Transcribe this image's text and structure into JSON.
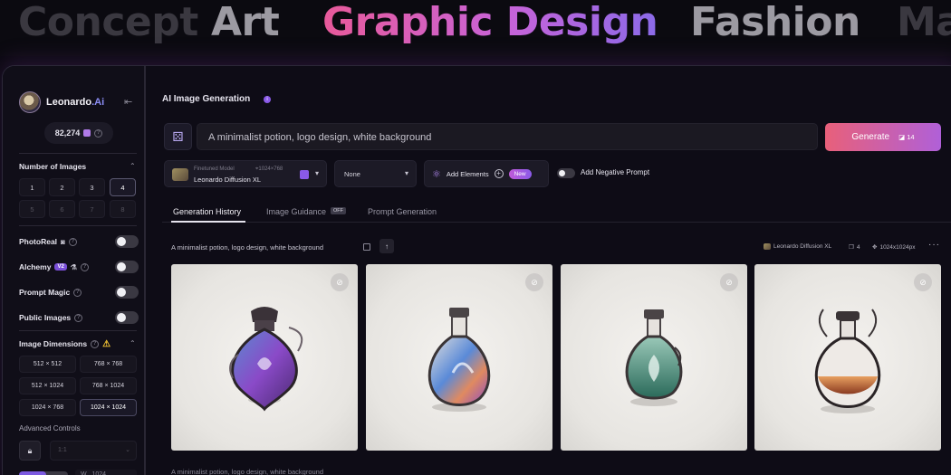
{
  "banner": {
    "words": [
      "Concept",
      "Art",
      "Graphic Design",
      "Fashion",
      "Ma"
    ]
  },
  "brand": {
    "name": "Leonardo",
    "suffix": ".Ai"
  },
  "sidebar": {
    "tokens": "82,274",
    "number_of_images": {
      "title": "Number of Images",
      "options": [
        "1",
        "2",
        "3",
        "4",
        "5",
        "6",
        "7",
        "8"
      ],
      "selected": "4"
    },
    "toggles": [
      {
        "label": "PhotoReal",
        "on": false
      },
      {
        "label": "Alchemy",
        "badge": "V2",
        "on": false
      },
      {
        "label": "Prompt Magic",
        "on": false
      },
      {
        "label": "Public Images",
        "on": false
      }
    ],
    "image_dimensions": {
      "title": "Image Dimensions",
      "options": [
        "512 × 512",
        "768 × 768",
        "512 × 1024",
        "768 × 1024",
        "1024 × 768",
        "1024 × 1024"
      ],
      "selected": "1024 × 1024"
    },
    "advanced_label": "Advanced Controls",
    "aspect_ratio": "1:1",
    "width_label": "W",
    "width_value": "1024"
  },
  "main": {
    "title": "AI Image Generation",
    "prompt": "A minimalist potion, logo design, white background",
    "generate_label": "Generate",
    "generate_cost": "14",
    "model": {
      "sub_label": "Finetuned Model",
      "size": "1024×768",
      "name": "Leonardo Diffusion XL"
    },
    "style_value": "None",
    "elements_label": "Add Elements",
    "new_badge": "New",
    "negative_prompt_label": "Add Negative Prompt",
    "tabs": [
      {
        "label": "Generation History",
        "active": true
      },
      {
        "label": "Image Guidance",
        "badge": "OFF"
      },
      {
        "label": "Prompt Generation"
      }
    ],
    "generation": {
      "prompt": "A minimalist potion, logo design, white background",
      "model": "Leonardo Diffusion XL",
      "count": "4",
      "size": "1024x1024px"
    },
    "next_generation_prompt": "A minimalist potion, logo design, white background"
  },
  "colors": {
    "accent_gradient_start": "#e8607a",
    "accent_gradient_end": "#b060d8",
    "brand_ai": "#8c8ef5"
  }
}
